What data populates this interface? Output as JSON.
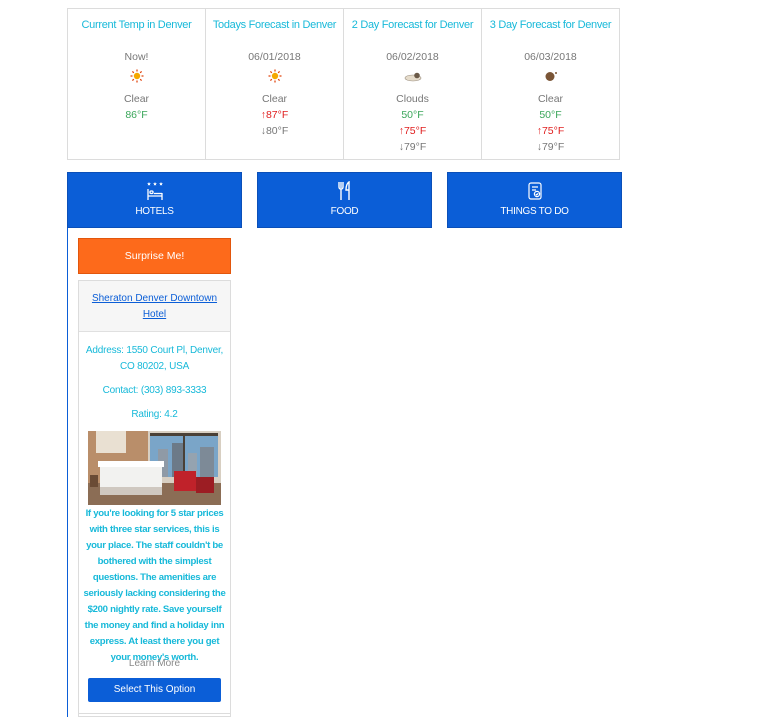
{
  "weather": {
    "current": {
      "title": "Current Temp in Denver",
      "date": "Now!",
      "icon": "sun-icon",
      "condition": "Clear",
      "temp": "86°F"
    },
    "today": {
      "title": "Todays Forecast in Denver",
      "date": "06/01/2018",
      "icon": "sun-icon",
      "condition": "Clear",
      "high": "↑87°F",
      "low": "↓80°F"
    },
    "day2": {
      "title": "2 Day Forecast for Denver",
      "date": "06/02/2018",
      "icon": "cloud-icon",
      "condition": "Clouds",
      "temp": "50°F",
      "high": "↑75°F",
      "low": "↓79°F"
    },
    "day3": {
      "title": "3 Day Forecast for Denver",
      "date": "06/03/2018",
      "icon": "moon-icon",
      "condition": "Clear",
      "temp": "50°F",
      "high": "↑75°F",
      "low": "↓79°F"
    }
  },
  "tabs": {
    "hotels": "HOTELS",
    "food": "FOOD",
    "things": "THINGS TO DO"
  },
  "surprise_label": "Surprise Me!",
  "hotel": {
    "name": "Sheraton Denver Downtown Hotel",
    "address": "Address: 1550 Court Pl, Denver, CO 80202, USA",
    "contact": "Contact: (303) 893-3333",
    "rating": "Rating: 4.2",
    "review": "If you're looking for 5 star prices with three star services, this is your place. The staff couldn't be bothered with the simplest questions. The amenities are seriously lacking considering the $200 nightly rate. Save yourself the money and find a holiday inn express. At least there you get your money's worth.",
    "learn_more": "Learn More",
    "select_label": "Select This Option"
  },
  "colors": {
    "accent": "#0b5ed7",
    "orange": "#fd6a1b",
    "teal": "#17b9d9"
  }
}
